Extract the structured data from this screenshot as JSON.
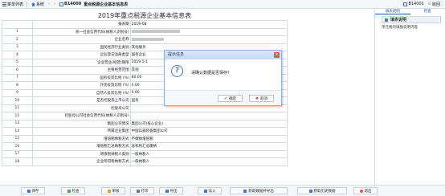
{
  "toolbar": {
    "menu_label": "菜单列表",
    "function_label": "系统",
    "form_code": "B14000",
    "form_name": "重点税源企业基本信息表",
    "right_code": "B14001",
    "right_switch": "收回"
  },
  "document": {
    "title": "2019年重点税源企业基本信息表",
    "rows": [
      {
        "num": "",
        "label": "报表期",
        "value": "2019-08"
      },
      {
        "num": "1",
        "label": "统一社会信用代码(纳税人识别号)",
        "value": "",
        "redacted": 60
      },
      {
        "num": "2",
        "label": "企业名称",
        "value": "",
        "redacted": 40
      },
      {
        "num": "3",
        "label": "国民经济行业类别",
        "value": "其他服务"
      },
      {
        "num": "4",
        "label": "企业登记注册类型",
        "value": "国有企业"
      },
      {
        "num": "5",
        "label": "企业营业(经营)期限",
        "value": "2019-5-1"
      },
      {
        "num": "6",
        "label": "主要经营范围",
        "value": "其他"
      },
      {
        "num": "7",
        "label": "国有投资比例 (%)",
        "value": "80.00"
      },
      {
        "num": "8",
        "label": "外资投资比例 (%)",
        "value": "0.00"
      },
      {
        "num": "9",
        "label": "自然人投资比例 (%)",
        "value": "0.00"
      },
      {
        "num": "10",
        "label": "是否控股或上市公司",
        "value": "国有"
      },
      {
        "num": "11",
        "label": "控股母公司",
        "value": ""
      },
      {
        "num": "12",
        "label": "控股母公司社会信用代码(纳税人识别号)",
        "value": ""
      },
      {
        "num": "13",
        "label": "集团公司情况",
        "value": "集团公司(核心企业)"
      },
      {
        "num": "14",
        "label": "所属企业集团",
        "value": "中国兵器装备集团公司"
      },
      {
        "num": "15",
        "label": "增值税纳税方式",
        "value": "不缴纳增值税"
      },
      {
        "num": "16",
        "label": "增值税汇总纳税方式",
        "value": "总机构汇总缴纳"
      },
      {
        "num": "17",
        "label": "增值税纳税人类别",
        "value": "一般纳税人"
      },
      {
        "num": "18",
        "label": "企业所得税纳税方式",
        "value": "一般纳税人"
      }
    ]
  },
  "right_panel": {
    "tabs": [
      "填表说明",
      "检查"
    ],
    "header": "填表说明",
    "body": "单元格的填报说明内容"
  },
  "bottom_bar": {
    "buttons": [
      "保存",
      "检查",
      "审核",
      "打印",
      "导出",
      "读入",
      "获取数据并导出",
      "获取历史数据",
      "退出"
    ]
  },
  "dialog": {
    "title": "提示信息",
    "message": "请确认数据是否保存？",
    "ok": "确定",
    "cancel": "取消"
  },
  "colors": {
    "accent": "#4a79c4",
    "close": "#e05a4e"
  }
}
